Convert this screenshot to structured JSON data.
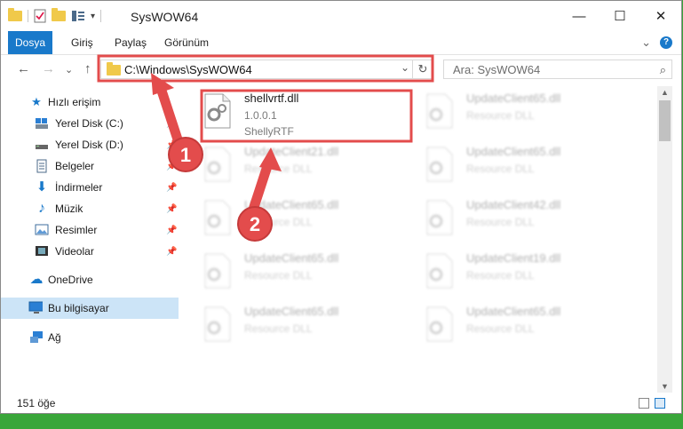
{
  "window": {
    "title": "SysWOW64",
    "controls": {
      "minimize": "—",
      "maximize": "☐",
      "close": "✕"
    }
  },
  "ribbon": {
    "tabs": [
      "Dosya",
      "Giriş",
      "Paylaş",
      "Görünüm"
    ],
    "help": "?",
    "expand": "⌄"
  },
  "nav": {
    "back": "←",
    "forward": "→",
    "dropdown": "⌄",
    "up": "↑",
    "address": "C:\\Windows\\SysWOW64",
    "refresh": "↻",
    "search_placeholder": "Ara: SysWOW64",
    "search_icon": "⌕"
  },
  "sidebar": {
    "items": [
      {
        "label": "Hızlı erişim",
        "icon": "star-icon",
        "glyph": "★",
        "color": "#1979ca",
        "pinned": false
      },
      {
        "label": "Yerel Disk (C:)",
        "icon": "drive-icon",
        "glyph": "▬",
        "color": "#3c6e9e",
        "pinned": true
      },
      {
        "label": "Yerel Disk (D:)",
        "icon": "drive-icon",
        "glyph": "▬",
        "color": "#555555",
        "pinned": true
      },
      {
        "label": "Belgeler",
        "icon": "documents-icon",
        "glyph": "▤",
        "color": "#4b6a8a",
        "pinned": true
      },
      {
        "label": "İndirmeler",
        "icon": "download-icon",
        "glyph": "⬇",
        "color": "#1979ca",
        "pinned": true
      },
      {
        "label": "Müzik",
        "icon": "music-icon",
        "glyph": "♪",
        "color": "#1979ca",
        "pinned": true
      },
      {
        "label": "Resimler",
        "icon": "pictures-icon",
        "glyph": "▣",
        "color": "#3c6e9e",
        "pinned": true
      },
      {
        "label": "Videolar",
        "icon": "video-icon",
        "glyph": "▦",
        "color": "#444444",
        "pinned": true
      },
      {
        "label": "OneDrive",
        "icon": "cloud-icon",
        "glyph": "☁",
        "color": "#1979ca",
        "pinned": false
      },
      {
        "label": "Bu bilgisayar",
        "icon": "computer-icon",
        "glyph": "▭",
        "color": "#1979ca",
        "pinned": false,
        "selected": true
      },
      {
        "label": "Ağ",
        "icon": "network-icon",
        "glyph": "⎔",
        "color": "#1979ca",
        "pinned": false
      }
    ]
  },
  "files": [
    {
      "name": "shellvrtf.dll",
      "line2": "1.0.0.1",
      "line3": "ShellyRTF",
      "highlighted": true
    },
    {
      "name": "UpdateClient65.dll",
      "line2": "Resource DLL"
    },
    {
      "name": "UpdateClient21.dll",
      "line2": "Resource DLL"
    },
    {
      "name": "UpdateClient65.dll",
      "line2": "Resource DLL"
    },
    {
      "name": "UpdateClient65.dll",
      "line2": "Resource DLL"
    },
    {
      "name": "UpdateClient42.dll",
      "line2": "Resource DLL"
    },
    {
      "name": "UpdateClient65.dll",
      "line2": "Resource DLL"
    },
    {
      "name": "UpdateClient19.dll",
      "line2": "Resource DLL"
    },
    {
      "name": "UpdateClient65.dll",
      "line2": "Resource DLL"
    },
    {
      "name": "UpdateClient65.dll",
      "line2": "Resource DLL"
    }
  ],
  "status": {
    "count": "151 öğe"
  },
  "annotations": {
    "step1": "1",
    "step2": "2",
    "color": "#e34c4c"
  }
}
